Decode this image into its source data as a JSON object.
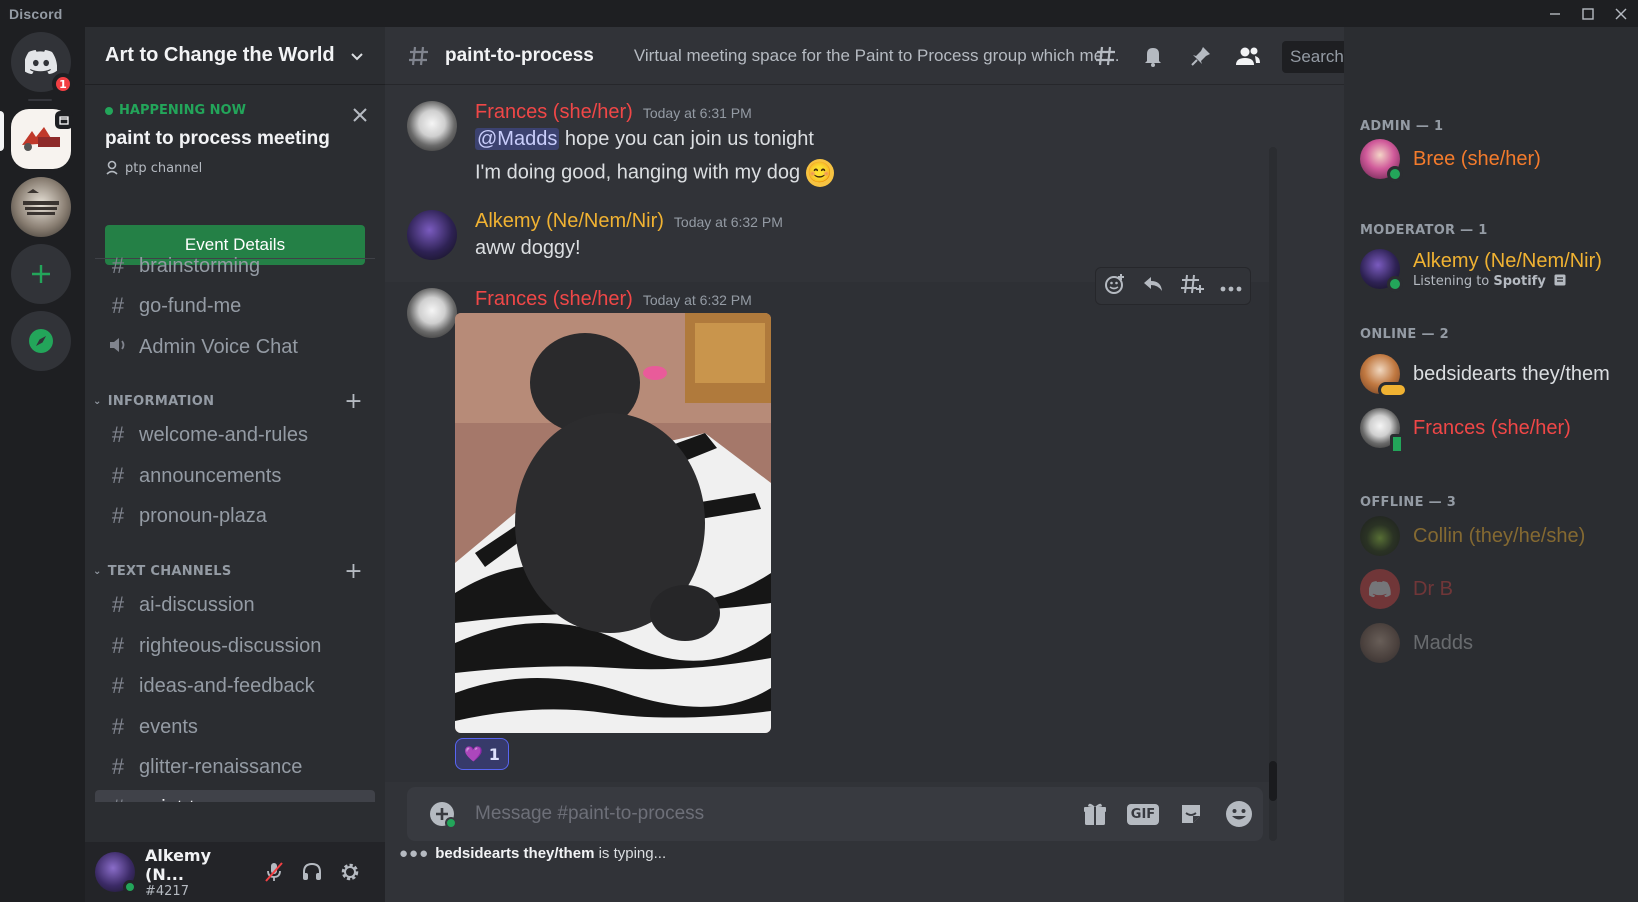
{
  "window": {
    "title": "Discord"
  },
  "rail": {
    "dm_badge": "1"
  },
  "guild": {
    "name": "Art to Change the World"
  },
  "event": {
    "status": "HAPPENING NOW",
    "title": "paint to process meeting",
    "location": "ptp channel",
    "button": "Event Details"
  },
  "channels_top": [
    {
      "name": "brainstorming"
    },
    {
      "name": "go-fund-me"
    },
    {
      "name": "Admin Voice Chat"
    }
  ],
  "categories": {
    "information": "INFORMATION",
    "text_channels": "TEXT CHANNELS"
  },
  "channels_info": [
    {
      "name": "welcome-and-rules"
    },
    {
      "name": "announcements"
    },
    {
      "name": "pronoun-plaza"
    }
  ],
  "channels_text": [
    {
      "name": "ai-discussion"
    },
    {
      "name": "righteous-discussion"
    },
    {
      "name": "ideas-and-feedback"
    },
    {
      "name": "events"
    },
    {
      "name": "glitter-renaissance"
    },
    {
      "name": "paint-to-process"
    }
  ],
  "user": {
    "name": "Alkemy (N...",
    "tag": "#4217"
  },
  "channel": {
    "name": "paint-to-process",
    "topic": "Virtual meeting space for the Paint to Process group which mee..."
  },
  "search": {
    "placeholder": "Search"
  },
  "messages": [
    {
      "author": "Frances (she/her)",
      "time": "Today at 6:31 PM",
      "mention": "@Madds",
      "line1": " hope you can join us tonight",
      "line2": "I'm doing good, hanging with my dog",
      "emoji": "😊"
    },
    {
      "author": "Alkemy (Ne/Nem/Nir)",
      "time": "Today at 6:32 PM",
      "line1": "aww doggy!"
    },
    {
      "author": "Frances (she/her)",
      "time": "Today at 6:32 PM",
      "reaction_emoji": "💜",
      "reaction_count": "1"
    }
  ],
  "composer": {
    "placeholder": "Message #paint-to-process",
    "gif": "GIF"
  },
  "typing": {
    "user": "bedsidearts they/them",
    "text": "is typing..."
  },
  "member_groups": {
    "admin": "ADMIN — 1",
    "moderator": "MODERATOR — 1",
    "online": "ONLINE — 2",
    "offline": "OFFLINE — 3"
  },
  "members": {
    "bree": {
      "name": "Bree (she/her)"
    },
    "alkemy": {
      "name": "Alkemy (Ne/Nem/Nir)",
      "activity_prefix": "Listening to ",
      "activity_app": "Spotify"
    },
    "bedside": {
      "name": "bedsidearts they/them"
    },
    "frances": {
      "name": "Frances (she/her)"
    },
    "collin": {
      "name": "Collin (they/he/she)"
    },
    "drb": {
      "name": "Dr B"
    },
    "madds": {
      "name": "Madds"
    }
  },
  "colors": {
    "admin": "#f47b2c",
    "moderator": "#f0b232",
    "frances": "#f04747",
    "online_green": "#23a55a",
    "blurple": "#5865f2"
  }
}
